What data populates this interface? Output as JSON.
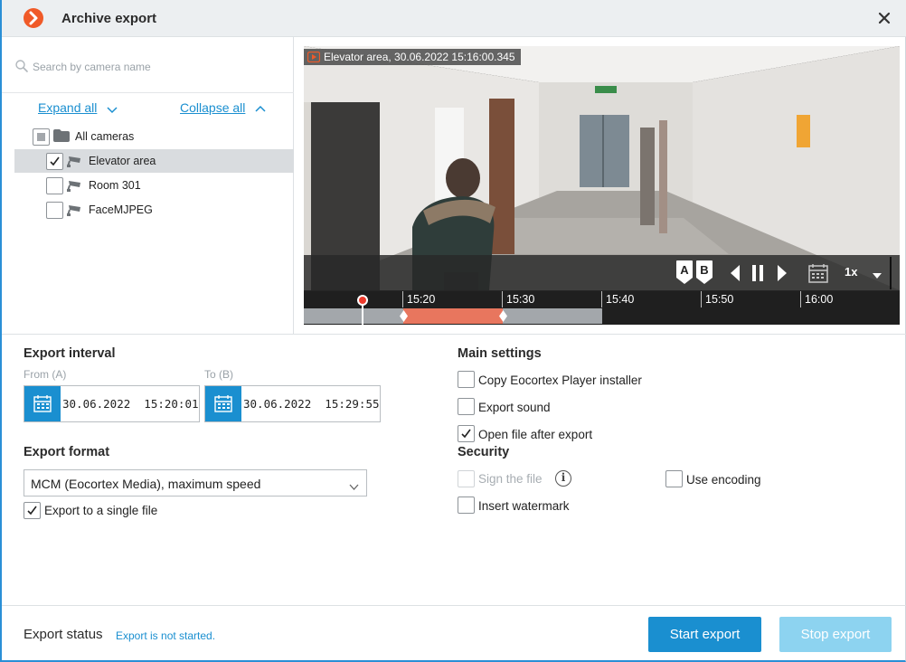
{
  "window": {
    "title": "Archive export",
    "close_icon": "close-icon",
    "logo_color": "#f05a28"
  },
  "camera_tree": {
    "search_placeholder": "Search by camera name",
    "expand_all": "Expand all",
    "collapse_all": "Collapse all",
    "root": {
      "label": "All cameras",
      "state": "partial"
    },
    "cameras": [
      {
        "label": "Elevator area",
        "checked": true,
        "selected": true
      },
      {
        "label": "Room 301",
        "checked": false,
        "selected": false
      },
      {
        "label": "FaceMJPEG",
        "checked": false,
        "selected": false
      }
    ]
  },
  "player": {
    "caption": "Elevator area, 30.06.2022 15:16:00.345",
    "marker_a": "A",
    "marker_b": "B",
    "speed": "1x",
    "timeline_ticks": [
      "15:20",
      "15:30",
      "15:40",
      "15:50",
      "16:00"
    ],
    "selection_color": "#e8765e",
    "cursor_color": "#ee3b2d"
  },
  "export_interval": {
    "title": "Export interval",
    "from_label": "From (A)",
    "from_value": "30.06.2022  15:20:01",
    "to_label": "To (B)",
    "to_value": "30.06.2022  15:29:55"
  },
  "export_format": {
    "title": "Export format",
    "selected": "MCM (Eocortex Media), maximum speed",
    "single_file_label": "Export to a single file",
    "single_file_checked": true
  },
  "main_settings": {
    "title": "Main settings",
    "options": [
      {
        "label": "Copy Eocortex Player installer",
        "checked": false
      },
      {
        "label": "Export sound",
        "checked": false
      },
      {
        "label": "Open file after export",
        "checked": true
      }
    ]
  },
  "security": {
    "title": "Security",
    "sign_file": {
      "label": "Sign the file",
      "checked": false,
      "disabled": true
    },
    "use_encoding": {
      "label": "Use encoding",
      "checked": false
    },
    "insert_watermark": {
      "label": "Insert watermark",
      "checked": false
    }
  },
  "footer": {
    "status_label": "Export status",
    "status_text": "Export is not started.",
    "start_button": "Start export",
    "stop_button": "Stop export",
    "accent_color": "#1a8fd0"
  }
}
